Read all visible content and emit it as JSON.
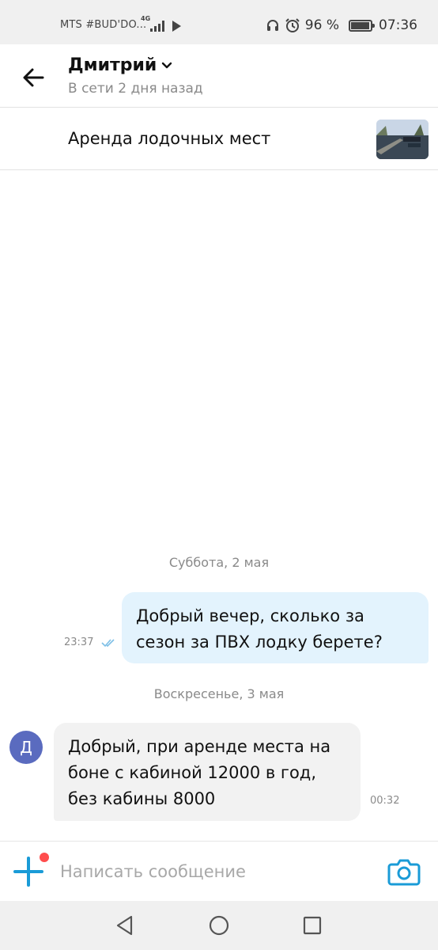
{
  "status_bar": {
    "carrier": "MTS #BUD'DO...",
    "network": "4G",
    "battery": "96 %",
    "battery_level": 0.96,
    "time": "07:36",
    "icons": [
      "signal-icon",
      "play-icon",
      "headphones-icon",
      "alarm-icon",
      "battery-icon"
    ]
  },
  "header": {
    "name": "Дмитрий",
    "status": "В сети 2 дня назад"
  },
  "listing": {
    "title": "Аренда лодочных мест"
  },
  "messages": {
    "sep1": "Суббота, 2 мая",
    "out_text": "Добрый вечер, сколько за сезон за ПВХ лодку берете?",
    "out_time": "23:37",
    "sep2": "Воскресенье, 3 мая",
    "avatar_letter": "Д",
    "in_text": "Добрый, при аренде места на боне с кабиной 12000 в год, без кабины 8000",
    "in_time": "00:32"
  },
  "composer": {
    "placeholder": "Написать сообщение"
  },
  "colors": {
    "accent": "#1a9bd7",
    "outgoing_bubble": "#e3f3fd",
    "incoming_bubble": "#f2f2f2",
    "avatar": "#5a6bbf",
    "badge": "#ff4d4d"
  }
}
